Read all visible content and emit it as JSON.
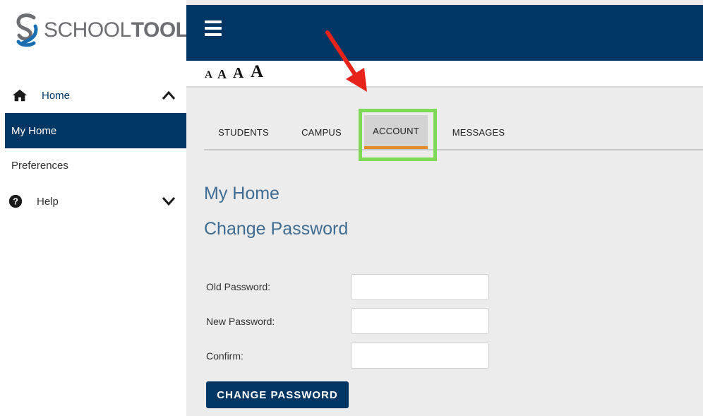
{
  "logo": {
    "text_thin": "SCHOOL",
    "text_bold": "TOOL",
    "colors": {
      "mark": "#1a6fb3",
      "text": "#6d6e71"
    }
  },
  "sidebar": {
    "items": [
      {
        "label": "Home",
        "icon": "home-icon",
        "chevron": "chevron-up-icon"
      },
      {
        "label": "My Home",
        "active": true
      },
      {
        "label": "Preferences"
      },
      {
        "label": "Help",
        "icon": "question-circle-icon",
        "chevron": "chevron-down-icon"
      }
    ]
  },
  "topbar": {
    "menu_icon": "hamburger-menu-icon",
    "color": "#003663"
  },
  "font_sizer": {
    "labels": [
      "A",
      "A",
      "A",
      "A"
    ]
  },
  "tabs": [
    {
      "label": "STUDENTS"
    },
    {
      "label": "CAMPUS"
    },
    {
      "label": "ACCOUNT",
      "active": true
    },
    {
      "label": "MESSAGES"
    }
  ],
  "annotations": {
    "highlight_color": "#7ed957",
    "arrow_color": "#e8231c"
  },
  "main": {
    "page_title": "My Home",
    "section_title": "Change Password",
    "form": {
      "old_label": "Old Password:",
      "new_label": "New Password:",
      "confirm_label": "Confirm:",
      "old_value": "",
      "new_value": "",
      "confirm_value": "",
      "submit_label": "CHANGE PASSWORD"
    }
  },
  "colors": {
    "brand": "#003663",
    "active_tab_underline": "#e08a2c",
    "heading": "#3f6c93"
  }
}
